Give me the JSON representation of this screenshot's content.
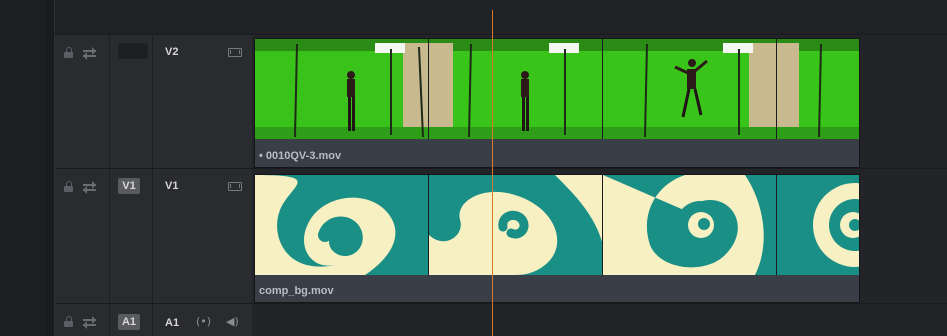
{
  "tracks": {
    "v2": {
      "dest": "",
      "name": "V2"
    },
    "v1": {
      "dest": "V1",
      "name": "V1"
    },
    "a1": {
      "dest": "A1",
      "name": "A1",
      "monitor_icon": "(•)",
      "speaker_icon": "◀)"
    }
  },
  "clips": {
    "v2": {
      "label": "• 0010QV-3.mov"
    },
    "v1": {
      "label": "comp_bg.mov"
    }
  },
  "colors": {
    "playhead": "#d9782c",
    "greenscreen": "#39c41a",
    "swirl_teal": "#1a8f86",
    "swirl_cream": "#f6f0c2"
  },
  "icons": [
    "lock-icon",
    "sync-icon",
    "film-icon",
    "monitor-icon",
    "speaker-icon"
  ]
}
